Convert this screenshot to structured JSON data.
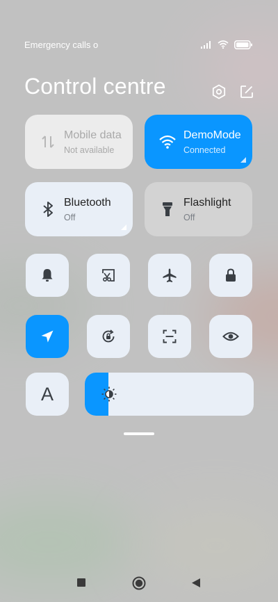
{
  "status_bar": {
    "carrier_text": "Emergency calls o",
    "icons": [
      "signal-icon",
      "wifi-icon",
      "battery-icon"
    ]
  },
  "header": {
    "title": "Control centre",
    "icons": [
      "settings-icon",
      "edit-icon"
    ]
  },
  "tiles": [
    {
      "label": "Mobile data",
      "status": "Not available",
      "icon": "mobile-data-icon",
      "state": "unavailable"
    },
    {
      "label": "DemoMode",
      "status": "Connected",
      "icon": "wifi-icon",
      "state": "active"
    },
    {
      "label": "Bluetooth",
      "status": "Off",
      "icon": "bluetooth-icon",
      "state": "off"
    },
    {
      "label": "Flashlight",
      "status": "Off",
      "icon": "flashlight-icon",
      "state": "off"
    }
  ],
  "toggles": [
    {
      "icon": "bell-icon",
      "active": false
    },
    {
      "icon": "screenshot-icon",
      "active": false
    },
    {
      "icon": "airplane-icon",
      "active": false
    },
    {
      "icon": "lock-icon",
      "active": false
    },
    {
      "icon": "location-icon",
      "active": true
    },
    {
      "icon": "rotation-lock-icon",
      "active": false
    },
    {
      "icon": "scanner-icon",
      "active": false
    },
    {
      "icon": "eye-icon",
      "active": false
    }
  ],
  "font_size_button": {
    "label": "A"
  },
  "brightness": {
    "level": 0.14,
    "icon": "sun-icon"
  },
  "nav_bar": {
    "icons": [
      "recents-icon",
      "home-icon",
      "back-icon"
    ]
  },
  "colors": {
    "accent": "#0a96ff",
    "tile_bg": "#e9eff7",
    "text_dark": "#222222",
    "text_muted": "#7a7f86"
  }
}
